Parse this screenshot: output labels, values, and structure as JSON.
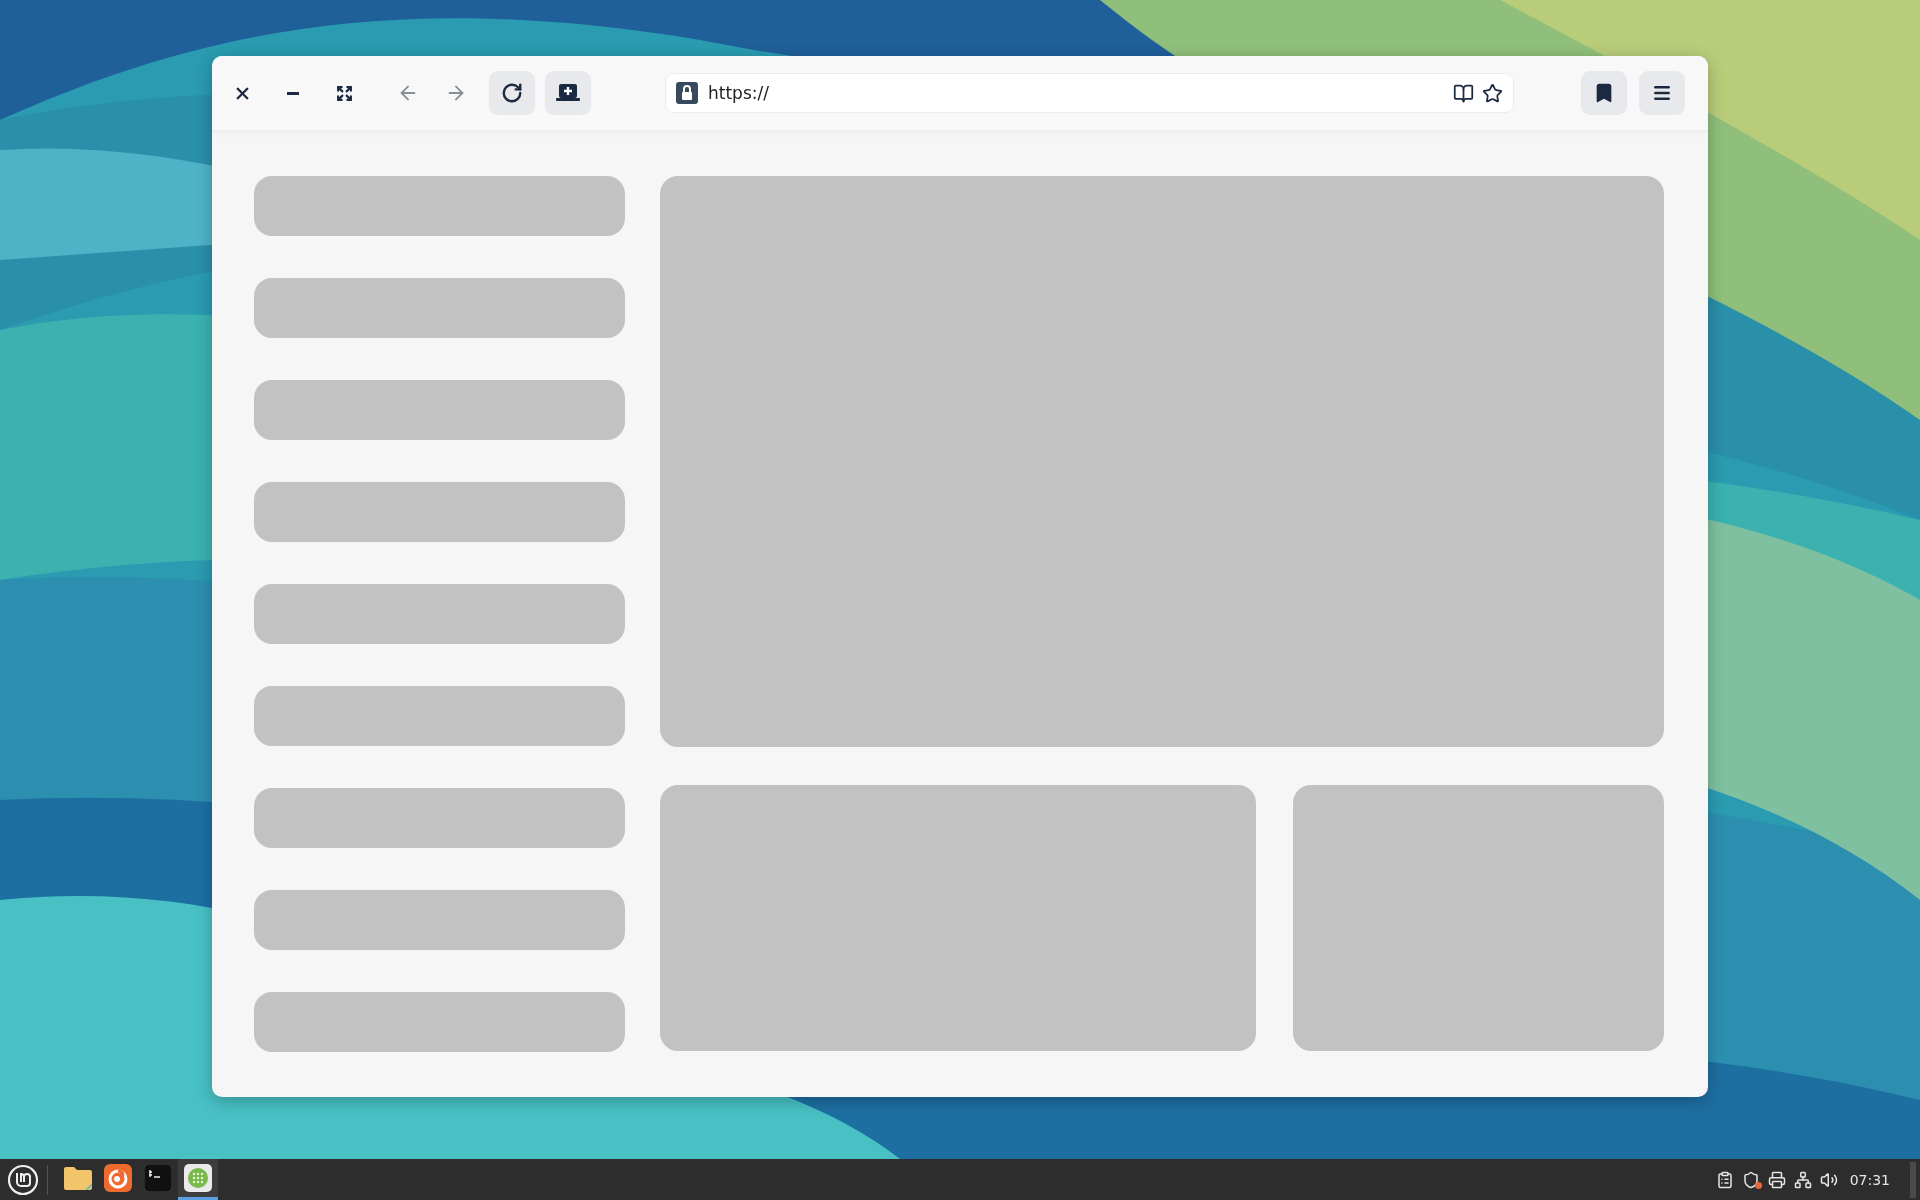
{
  "window": {
    "controls": [
      {
        "kind": "close"
      },
      {
        "kind": "minimize"
      },
      {
        "kind": "maximize"
      }
    ],
    "navigation": [
      {
        "kind": "back",
        "disabled": true
      },
      {
        "kind": "forward",
        "disabled": true
      },
      {
        "kind": "reload",
        "disabled": false
      },
      {
        "kind": "add-tab",
        "disabled": false
      }
    ],
    "address_bar": {
      "value": "https://"
    },
    "address_actions": [
      {
        "kind": "reader"
      },
      {
        "kind": "star"
      }
    ],
    "actions": [
      {
        "kind": "bookmarks"
      },
      {
        "kind": "menu"
      }
    ],
    "content": {
      "sidebar": [
        {
          "kind": "skeleton"
        },
        {
          "kind": "skeleton"
        },
        {
          "kind": "skeleton"
        },
        {
          "kind": "skeleton"
        },
        {
          "kind": "skeleton"
        },
        {
          "kind": "skeleton"
        },
        {
          "kind": "skeleton"
        },
        {
          "kind": "skeleton"
        },
        {
          "kind": "skeleton"
        }
      ],
      "panels": [
        {
          "kind": "skeleton"
        },
        {
          "kind": "skeleton"
        },
        {
          "kind": "skeleton"
        }
      ]
    }
  },
  "taskbar": {
    "apps": [
      {
        "kind": "files",
        "selected": false
      },
      {
        "kind": "browser",
        "selected": false
      },
      {
        "kind": "terminal",
        "selected": false
      },
      {
        "kind": "webapp",
        "selected": true
      }
    ],
    "tray": [
      {
        "kind": "clipboard"
      },
      {
        "kind": "shield"
      },
      {
        "kind": "printer"
      },
      {
        "kind": "network"
      },
      {
        "kind": "volume"
      }
    ],
    "clock": "07:31"
  }
}
